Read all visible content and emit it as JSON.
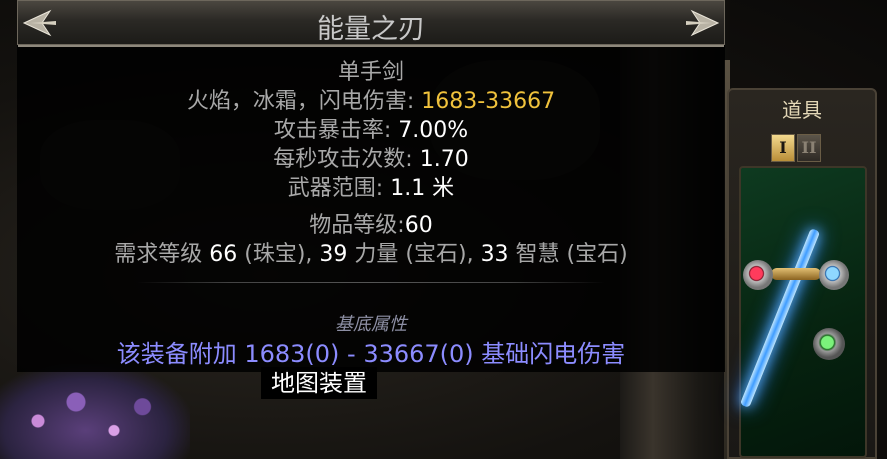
{
  "tooltip": {
    "title": "能量之刃",
    "item_class": "单手剑",
    "damage_label": "火焰，冰霜，闪电伤害: ",
    "damage_value": "1683-33667",
    "crit_label": "攻击暴击率: ",
    "crit_value": "7.00%",
    "aps_label": "每秒攻击次数: ",
    "aps_value": "1.70",
    "range_label": "武器范围: ",
    "range_value": "1.1 米",
    "ilvl_label": "物品等级:",
    "ilvl_value": "60",
    "req_prefix": "需求等级 ",
    "req_level": "66",
    "req_level_src": " (珠宝), ",
    "req_str": "39",
    "req_str_label": " 力量 (宝石), ",
    "req_int": "33",
    "req_int_label": " 智慧 (宝石)",
    "base_section_label": "基底属性",
    "enchant_text": "该装备附加 1683(0) - 33667(0) 基础闪电伤害"
  },
  "map_label": "地图装置",
  "side_panel": {
    "title": "道具",
    "tabs": [
      "I",
      "II"
    ]
  },
  "colors": {
    "gold": "#f0c23c",
    "enchant_blue": "#8c8cff",
    "label_grey": "#a8a8a8"
  },
  "icons": [
    "ornament-left-icon",
    "ornament-right-icon",
    "red-gem-icon",
    "blue-gem-icon",
    "green-gem-icon",
    "lightning-sword-icon"
  ]
}
